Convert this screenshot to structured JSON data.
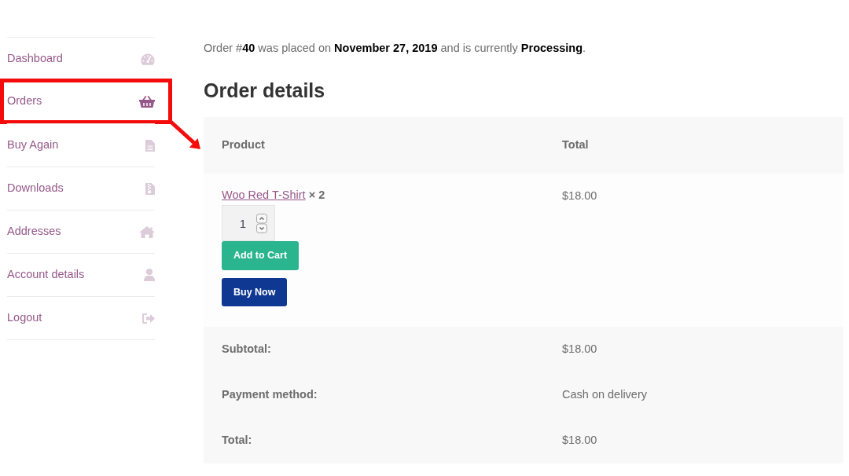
{
  "sidebar": {
    "items": [
      {
        "label": "Dashboard",
        "selected": false,
        "highlighted": false
      },
      {
        "label": "Orders",
        "selected": true,
        "highlighted": true
      },
      {
        "label": "Buy Again",
        "selected": false,
        "highlighted": false
      },
      {
        "label": "Downloads",
        "selected": false,
        "highlighted": false
      },
      {
        "label": "Addresses",
        "selected": false,
        "highlighted": false
      },
      {
        "label": "Account details",
        "selected": false,
        "highlighted": false
      },
      {
        "label": "Logout",
        "selected": false,
        "highlighted": false
      }
    ]
  },
  "order_summary": "Order #**40** was placed on **November 27, 2019** and is currently **Processing**.",
  "heading": "Order details",
  "table": {
    "columns": [
      "Product",
      "Total"
    ],
    "items": [
      {
        "name": "Woo Red T-Shirt",
        "quantity": "× 2",
        "total": "$18.00",
        "reorder_quantity": "1",
        "actions": [
          {
            "label": "Add to Cart",
            "kind": "add"
          },
          {
            "label": "Buy Now",
            "kind": "buy"
          }
        ]
      }
    ],
    "totals": [
      {
        "label": "Subtotal:",
        "value": "$18.00"
      },
      {
        "label": "Payment method:",
        "value": "Cash on delivery"
      },
      {
        "label": "Total:",
        "value": "$18.00"
      }
    ]
  }
}
